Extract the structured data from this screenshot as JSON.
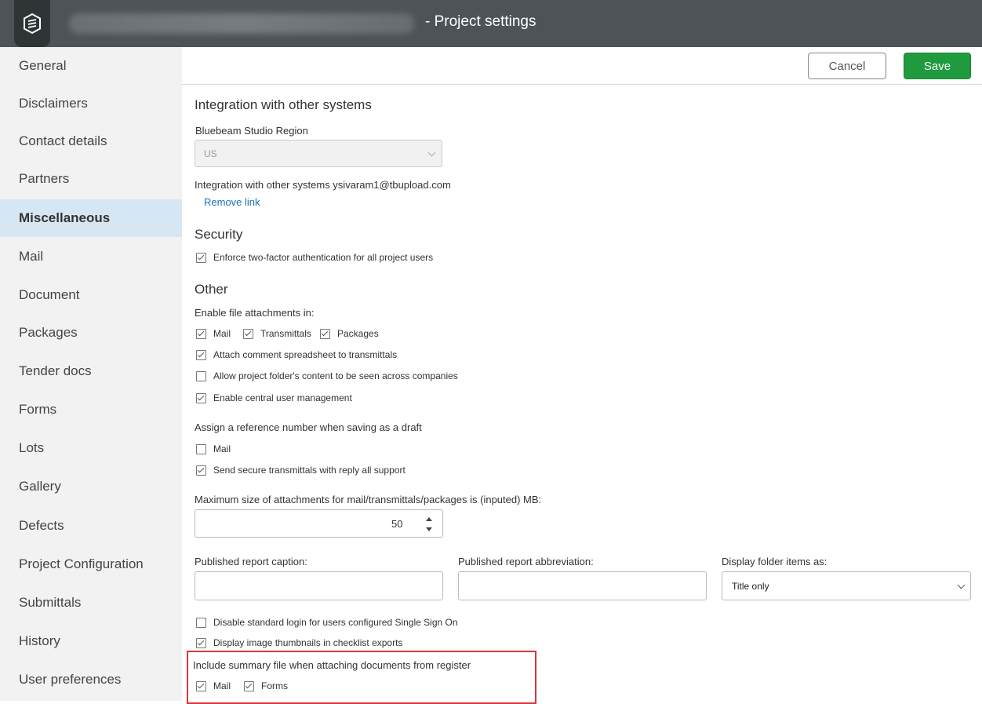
{
  "window": {
    "title": "- Project settings"
  },
  "sidebar": {
    "items": [
      {
        "label": "General"
      },
      {
        "label": "Disclaimers"
      },
      {
        "label": "Contact details"
      },
      {
        "label": "Partners"
      },
      {
        "label": "Miscellaneous",
        "active": true
      },
      {
        "label": "Mail"
      },
      {
        "label": "Document"
      },
      {
        "label": "Packages"
      },
      {
        "label": "Tender docs"
      },
      {
        "label": "Forms"
      },
      {
        "label": "Lots"
      },
      {
        "label": "Gallery"
      },
      {
        "label": "Defects"
      },
      {
        "label": "Project Configuration"
      },
      {
        "label": "Submittals"
      },
      {
        "label": "History"
      },
      {
        "label": "User preferences"
      }
    ]
  },
  "toolbar": {
    "cancel_label": "Cancel",
    "save_label": "Save"
  },
  "integration": {
    "heading": "Integration with other systems",
    "region_label": "Bluebeam Studio Region",
    "region_value": "US",
    "linked_text": "Integration with other systems ysivaram1@tbupload.com",
    "remove_link": "Remove link"
  },
  "security": {
    "heading": "Security",
    "two_factor": {
      "label": "Enforce two-factor authentication for all project users",
      "checked": true
    }
  },
  "other": {
    "heading": "Other",
    "attachments_label": "Enable file attachments in:",
    "attach_mail": {
      "label": "Mail",
      "checked": true
    },
    "attach_transmittals": {
      "label": "Transmittals",
      "checked": true
    },
    "attach_packages": {
      "label": "Packages",
      "checked": true
    },
    "comment_spreadsheet": {
      "label": "Attach comment spreadsheet to transmittals",
      "checked": true
    },
    "folder_across": {
      "label": "Allow project folder's content to be seen across companies",
      "checked": false
    },
    "central_user": {
      "label": "Enable central user management",
      "checked": true
    },
    "ref_label": "Assign a reference number when saving as a draft",
    "ref_mail": {
      "label": "Mail",
      "checked": false
    },
    "secure_transmittals": {
      "label": "Send secure transmittals with reply all support",
      "checked": true
    },
    "max_size_label": "Maximum size of attachments for mail/transmittals/packages is (inputed) MB:",
    "max_size_value": "50",
    "caption_label": "Published report caption:",
    "caption_value": "",
    "abbrev_label": "Published report abbreviation:",
    "abbrev_value": "",
    "display_label": "Display folder items as:",
    "display_value": "Title only",
    "disable_login": {
      "label": "Disable standard login for users configured Single Sign On",
      "checked": false
    },
    "thumbnails": {
      "label": "Display image thumbnails in checklist exports",
      "checked": true
    },
    "summary_label": "Include summary file when attaching documents from register",
    "summary_mail": {
      "label": "Mail",
      "checked": true
    },
    "summary_forms": {
      "label": "Forms",
      "checked": true
    }
  },
  "colors": {
    "titlebar": "#4d5356",
    "accent_save": "#1f9a3e",
    "link": "#1d6fb8",
    "active_nav": "#d7e6f3",
    "highlight": "#d9363e"
  }
}
